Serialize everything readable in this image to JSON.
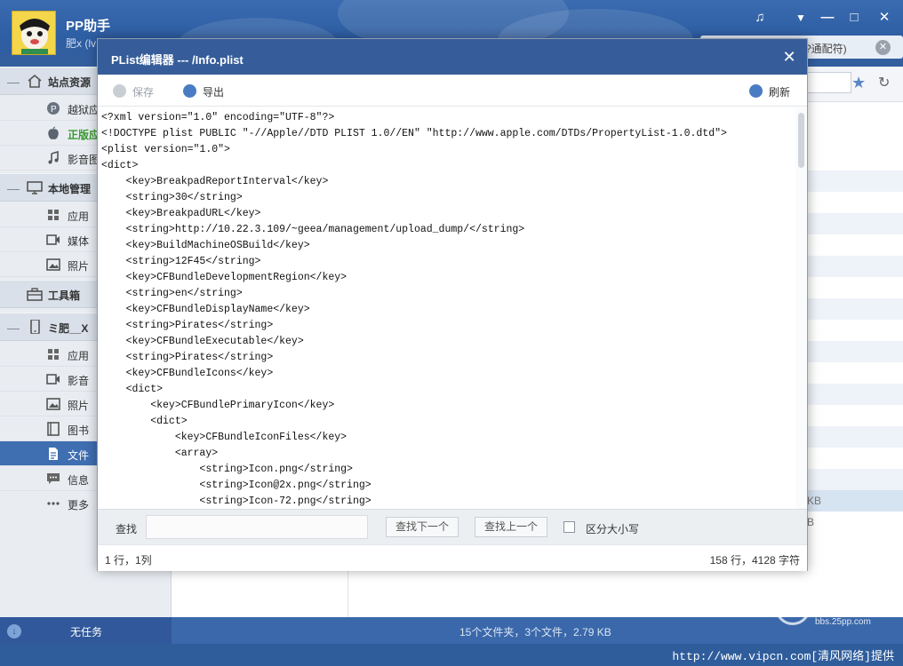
{
  "app": {
    "title": "PP助手",
    "user": "肥x (lv",
    "search_hint": "?通配符)"
  },
  "window_controls": {
    "music": "♫",
    "menu": "▼",
    "minimize": "—",
    "maximize": "□",
    "close": "✕"
  },
  "sidebar": {
    "groups": [
      {
        "label": "站点资源",
        "items": [
          {
            "label": "越狱应"
          },
          {
            "label": "正版应"
          },
          {
            "label": "影音图"
          }
        ]
      },
      {
        "label": "本地管理",
        "items": [
          {
            "label": "应用"
          },
          {
            "label": "媒体"
          },
          {
            "label": "照片"
          }
        ]
      },
      {
        "label": "工具箱",
        "items": []
      },
      {
        "label": "ミ肥__X",
        "items": [
          {
            "label": "应用"
          },
          {
            "label": "影音"
          },
          {
            "label": "照片"
          },
          {
            "label": "图书"
          },
          {
            "label": "文件"
          },
          {
            "label": "信息"
          },
          {
            "label": "更多"
          }
        ]
      }
    ]
  },
  "background": {
    "list_cells": [
      "KB",
      "B"
    ]
  },
  "status_bar": {
    "task_label": "无任务",
    "summary": "15个文件夹，3个文件，2.79 KB",
    "watermark_name": "PP助手",
    "watermark_url": "bbs.25pp.com",
    "credit": "http://www.vipcn.com[清风网络]提供"
  },
  "editor": {
    "title": "PList编辑器 --- /Info.plist",
    "close": "✕",
    "toolbar": {
      "save_label": "保存",
      "export_label": "导出",
      "refresh_label": "刷新"
    },
    "lines": [
      "<?xml version=\"1.0\" encoding=\"UTF-8\"?>",
      "<!DOCTYPE plist PUBLIC \"-//Apple//DTD PLIST 1.0//EN\" \"http://www.apple.com/DTDs/PropertyList-1.0.dtd\">",
      "<plist version=\"1.0\">",
      "<dict>",
      "    <key>BreakpadReportInterval</key>",
      "    <string>30</string>",
      "    <key>BreakpadURL</key>",
      "    <string>http://10.22.3.109/~geea/management/upload_dump/</string>",
      "    <key>BuildMachineOSBuild</key>",
      "    <string>12F45</string>",
      "    <key>CFBundleDevelopmentRegion</key>",
      "    <string>en</string>",
      "    <key>CFBundleDisplayName</key>",
      "    <string>Pirates</string>",
      "    <key>CFBundleExecutable</key>",
      "    <string>Pirates</string>",
      "    <key>CFBundleIcons</key>",
      "    <dict>",
      "        <key>CFBundlePrimaryIcon</key>",
      "        <dict>",
      "            <key>CFBundleIconFiles</key>",
      "            <array>",
      "                <string>Icon.png</string>",
      "                <string>Icon@2x.png</string>",
      "                <string>Icon-72.png</string>"
    ],
    "find": {
      "label": "查找",
      "value": "",
      "next_label": "查找下一个",
      "prev_label": "查找上一个",
      "case_label": "区分大小写",
      "case_checked": false
    },
    "status": {
      "cursor": "1 行，1列",
      "stats": "158 行，4128 字符"
    }
  },
  "colors": {
    "header": "#2e5ea3",
    "modal_title": "#365d99",
    "sidebar_active": "#3f6eb1",
    "status_bar": "#3a68ab",
    "green_label": "#3a9a2f"
  }
}
